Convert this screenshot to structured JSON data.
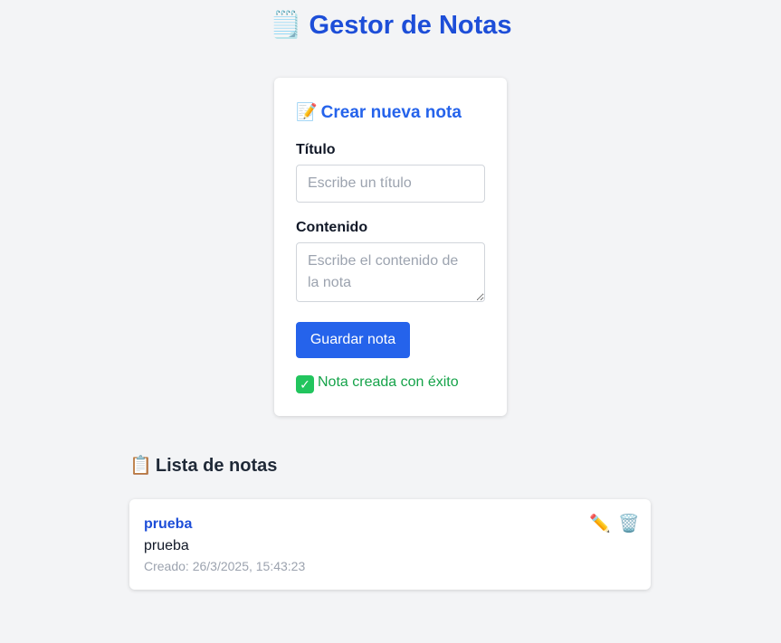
{
  "header": {
    "title": "Gestor de Notas",
    "title_icon": "🗒️"
  },
  "form": {
    "heading": "Crear nueva nota",
    "heading_icon": "📝",
    "title_label": "Título",
    "title_placeholder": "Escribe un título",
    "title_value": "",
    "content_label": "Contenido",
    "content_placeholder": "Escribe el contenido de la nota",
    "content_value": "",
    "save_label": "Guardar nota",
    "success_message": "Nota creada con éxito",
    "success_icon": "✓"
  },
  "list": {
    "heading": "Lista de notas",
    "heading_icon": "📋",
    "notes": [
      {
        "title": "prueba",
        "content": "prueba",
        "created": "Creado: 26/3/2025, 15:43:23",
        "edit_icon": "✏️",
        "delete_icon": "🗑️"
      }
    ]
  },
  "colors": {
    "accent": "#2563eb",
    "title": "#1d4ed8",
    "success": "#16a34a",
    "background": "#f3f4f6"
  }
}
